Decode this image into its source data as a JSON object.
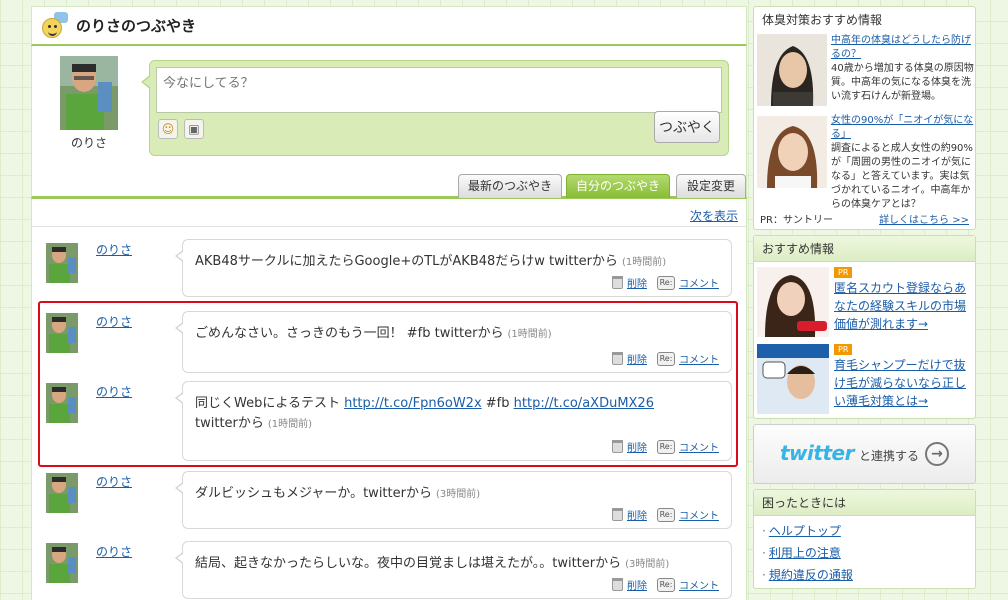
{
  "header": {
    "title": "のりさのつぶやき"
  },
  "composer": {
    "user_name": "のりさ",
    "placeholder": "今なにしてる？",
    "submit_label": "つぶやく"
  },
  "tabs": [
    {
      "label": "最新のつぶやき",
      "active": false
    },
    {
      "label": "自分のつぶやき",
      "active": true
    },
    {
      "label": "設定変更",
      "active": false
    }
  ],
  "timeline": {
    "next_label": "次を表示",
    "delete_label": "削除",
    "comment_label": "コメント",
    "items": [
      {
        "user": "のりさ",
        "text": "AKB48サークルに加えたらGoogle+のTLがAKB48だらけw twitterから",
        "time": "(1時間前)"
      },
      {
        "user": "のりさ",
        "text": "ごめんなさい。さっきのもう一回！ #fb twitterから",
        "time": "(1時間前)"
      },
      {
        "user": "のりさ",
        "text_before": "同じくWebによるテスト ",
        "link1": "http://t.co/Fpn6oW2x",
        "text_mid": " #fb ",
        "link2": "http://t.co/aXDuMX26",
        "text_after": " twitterから",
        "time": "(1時間前)"
      },
      {
        "user": "のりさ",
        "text": "ダルビッシュもメジャーか。twitterから",
        "time": "(3時間前)"
      },
      {
        "user": "のりさ",
        "text": "結局、起きなかったらしいな。夜中の目覚ましは堪えたが。。twitterから",
        "time": "(3時間前)"
      }
    ]
  },
  "sidebar": {
    "ad_panel": {
      "title": "体臭対策おすすめ情報",
      "entries": [
        {
          "lead": "中高年の体臭はどうしたら防げるの？",
          "body": "40歳から増加する体臭の原因物質。中高年の気になる体臭を洗い流す石けんが新登場。"
        },
        {
          "lead": "女性の90%が「ニオイが気になる」",
          "body": "調査によると成人女性の約90%が「周囲の男性のニオイが気になる」と答えています。実は気づかれているニオイ。中高年からの体臭ケアとは？"
        }
      ],
      "pr_label": "PR：サントリー",
      "more_label": "詳しくはこちら >>"
    },
    "recommend_panel": {
      "title": "おすすめ情報",
      "entries": [
        {
          "badge": "PR",
          "text": "匿名スカウト登録ならあなたの経験スキルの市場価値が測れます→"
        },
        {
          "badge": "PR",
          "text": "育毛シャンプーだけで抜け毛が減らないなら正しい薄毛対策とは→"
        }
      ]
    },
    "twitter_panel": {
      "logo": "twitter",
      "label": "と連携する"
    },
    "help_panel": {
      "title": "困ったときには",
      "links": [
        "ヘルプトップ",
        "利用上の注意",
        "規約違反の通報"
      ]
    }
  },
  "colors": {
    "accent": "#9cc85a",
    "highlight": "#d80b17",
    "link": "#1a5da8"
  }
}
